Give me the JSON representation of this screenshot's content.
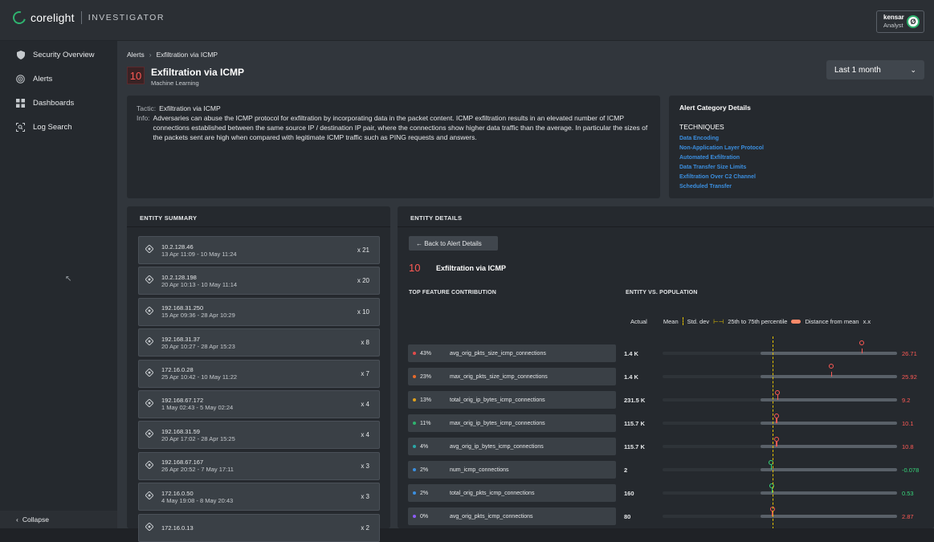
{
  "header": {
    "brand": "corelight",
    "product": "INVESTIGATOR",
    "user_name": "kensar",
    "user_role": "Analyst",
    "avatar_initial": "Ø"
  },
  "sidebar": {
    "items": [
      {
        "label": "Security Overview",
        "icon": "shield-icon"
      },
      {
        "label": "Alerts",
        "icon": "radar-icon"
      },
      {
        "label": "Dashboards",
        "icon": "grid-icon"
      },
      {
        "label": "Log Search",
        "icon": "search-icon"
      }
    ],
    "collapse_label": "Collapse"
  },
  "breadcrumb": {
    "root": "Alerts",
    "current": "Exfiltration via ICMP"
  },
  "alert": {
    "severity": "10",
    "title": "Exfiltration via ICMP",
    "subtitle": "Machine Learning"
  },
  "time_range": "Last 1 month",
  "info": {
    "tactic_key": "Tactic:",
    "tactic": "Exfiltration via ICMP",
    "info_key": "Info:",
    "info": "Adversaries can abuse the ICMP protocol for exfiltration by incorporating data in the packet content. ICMP exfiltration results in an elevated number of ICMP connections established between the same source IP / destination IP pair, where the connections show higher data traffic than the average. In particular the sizes of the packets sent are high when compared with legitimate ICMP traffic such as PING requests and answers."
  },
  "category": {
    "title": "Alert Category Details",
    "techniques_label": "TECHNIQUES",
    "techniques": [
      "Data Encoding",
      "Non-Application Layer Protocol",
      "Automated Exfiltration",
      "Data Transfer Size Limits",
      "Exfiltration Over C2 Channel",
      "Scheduled Transfer"
    ]
  },
  "entity_summary": {
    "title": "ENTITY SUMMARY",
    "items": [
      {
        "ip": "10.2.128.46",
        "range": "13 Apr 11:09 - 10 May 11:24",
        "count": "x 21"
      },
      {
        "ip": "10.2.128.198",
        "range": "20 Apr 10:13 - 10 May 11:14",
        "count": "x 20"
      },
      {
        "ip": "192.168.31.250",
        "range": "15 Apr 09:36 - 28 Apr 10:29",
        "count": "x 10"
      },
      {
        "ip": "192.168.31.37",
        "range": "20 Apr 10:27 - 28 Apr 15:23",
        "count": "x 8"
      },
      {
        "ip": "172.16.0.28",
        "range": "25 Apr 10:42 - 10 May 11:22",
        "count": "x 7"
      },
      {
        "ip": "192.168.67.172",
        "range": "1 May 02:43 - 5 May 02:24",
        "count": "x 4"
      },
      {
        "ip": "192.168.31.59",
        "range": "20 Apr 17:02 - 28 Apr 15:25",
        "count": "x 4"
      },
      {
        "ip": "192.168.67.167",
        "range": "26 Apr 20:52 - 7 May 17:11",
        "count": "x 3"
      },
      {
        "ip": "172.16.0.50",
        "range": "4 May 19:08 - 8 May 20:43",
        "count": "x 3"
      },
      {
        "ip": "172.16.0.13",
        "range": "",
        "count": "x 2"
      }
    ]
  },
  "entity_details": {
    "title": "ENTITY DETAILS",
    "back_label": "← Back to Alert Details",
    "severity": "10",
    "alert_title": "Exfiltration via ICMP",
    "top_feature_label": "TOP FEATURE CONTRIBUTION",
    "entity_vs_pop_label": "ENTITY VS. POPULATION",
    "legend": {
      "actual": "Actual",
      "mean": "Mean",
      "std": "Std. dev",
      "pct": "25th to 75th percentile",
      "dist": "Distance from mean",
      "dist_suffix": "x.x"
    },
    "colors": {
      "positive": "#ff5a55",
      "negative": "#37d67a",
      "mean": "#e2c000"
    },
    "features": [
      {
        "pct": "43%",
        "name": "avg_orig_pkts_size_icmp_connections",
        "dot": "#e24b4b",
        "actual": "1.4 K",
        "dist": "26.71",
        "sign": "pos",
        "marker": 0.85
      },
      {
        "pct": "23%",
        "name": "max_orig_pkts_size_icmp_connections",
        "dot": "#e86a2b",
        "actual": "1.4 K",
        "dist": "25.92",
        "sign": "pos",
        "marker": 0.72
      },
      {
        "pct": "13%",
        "name": "total_orig_ip_bytes_icmp_connections",
        "dot": "#e0a21d",
        "actual": "231.5 K",
        "dist": "9.2",
        "sign": "pos",
        "marker": 0.49
      },
      {
        "pct": "11%",
        "name": "max_orig_ip_bytes_icmp_connections",
        "dot": "#2fb36f",
        "actual": "115.7 K",
        "dist": "10.1",
        "sign": "pos",
        "marker": 0.486
      },
      {
        "pct": "4%",
        "name": "avg_orig_ip_bytes_icmp_connections",
        "dot": "#2aa7a7",
        "actual": "115.7 K",
        "dist": "10.8",
        "sign": "pos",
        "marker": 0.486
      },
      {
        "pct": "2%",
        "name": "num_icmp_connections",
        "dot": "#3b8fe0",
        "actual": "2",
        "dist": "-0.078",
        "sign": "neg",
        "marker": 0.463
      },
      {
        "pct": "2%",
        "name": "total_orig_pkts_icmp_connections",
        "dot": "#3b8fe0",
        "actual": "160",
        "dist": "0.53",
        "sign": "neg",
        "marker": 0.466
      },
      {
        "pct": "0%",
        "name": "avg_orig_pkts_icmp_connections",
        "dot": "#8b5cf6",
        "actual": "80",
        "dist": "2.87",
        "sign": "pos",
        "marker": 0.468
      }
    ]
  }
}
